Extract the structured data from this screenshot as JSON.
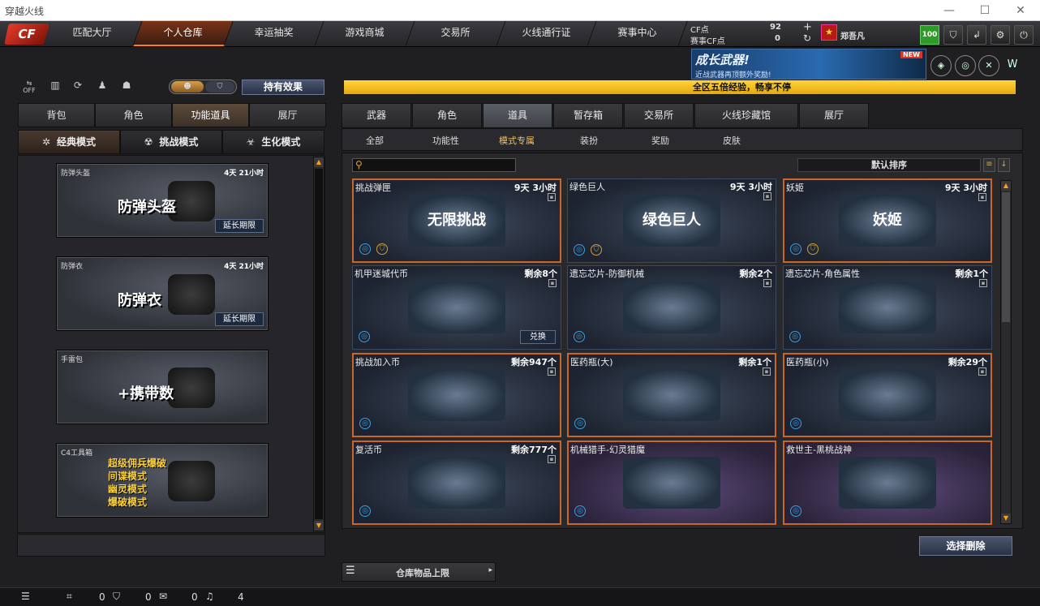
{
  "window": {
    "title": "穿越火线",
    "min": "—",
    "max": "☐",
    "close": "✕"
  },
  "nav": {
    "logo": "CF",
    "tabs": [
      "匹配大厅",
      "个人仓库",
      "幸运抽奖",
      "游戏商城",
      "交易所",
      "火线通行证",
      "赛事中心"
    ],
    "active": 1
  },
  "currency": {
    "cf_label": "CF点",
    "cf_value": "92",
    "event_label": "赛事CF点",
    "event_value": "0",
    "plus": "+",
    "refresh": "↻"
  },
  "user": {
    "name": "郑吾凡",
    "level": "100"
  },
  "banner": {
    "title": "成长武器!",
    "subtitle": "近战武器再顶额外奖励!",
    "badge": "NEW"
  },
  "ticker": {
    "text": "全区五倍经验，畅享不停"
  },
  "left": {
    "toggle": {
      "off": "OFF"
    },
    "effect_button": "持有效果",
    "tabs": [
      "背包",
      "角色",
      "功能道具",
      "展厅"
    ],
    "active_tab": 2,
    "modes": [
      "经典模式",
      "挑战模式",
      "生化模式"
    ],
    "active_mode": 0,
    "cards": [
      {
        "name": "防弹头盔",
        "time": "4天 21小时",
        "big": "防弹头盔",
        "extend": "延长期限"
      },
      {
        "name": "防弹衣",
        "time": "4天 21小时",
        "big": "防弹衣",
        "extend": "延长期限"
      },
      {
        "name": "手雷包",
        "time": "",
        "big": "+携带数",
        "extend": ""
      },
      {
        "name": "C4工具箱",
        "time": "",
        "lines": [
          "超级佣兵爆破",
          "间谍模式",
          "幽灵模式",
          "爆破模式"
        ],
        "extend": ""
      }
    ]
  },
  "right": {
    "tabs": [
      "武器",
      "角色",
      "道具",
      "暂存箱",
      "交易所",
      "火线珍藏馆",
      "展厅"
    ],
    "active_tab": 2,
    "subtabs": [
      "全部",
      "功能性",
      "模式专属",
      "装扮",
      "奖励",
      "皮肤"
    ],
    "active_sub": 2,
    "search_placeholder": "",
    "sort_label": "默认排序",
    "cards": [
      {
        "name": "挑战弹匣",
        "count": "9天 3小时",
        "art": "无限挑战",
        "sel": true
      },
      {
        "name": "绿色巨人",
        "count": "9天 3小时",
        "art": "绿色巨人",
        "sel": false
      },
      {
        "name": "妖姬",
        "count": "9天 3小时",
        "art": "妖姬",
        "sel": true
      },
      {
        "name": "机甲迷城代币",
        "count": "剩余8个",
        "art": "",
        "sel": false,
        "redeem": "兑换"
      },
      {
        "name": "遗忘芯片-防御机械",
        "count": "剩余2个",
        "art": "",
        "sel": false
      },
      {
        "name": "遗忘芯片-角色属性",
        "count": "剩余1个",
        "art": "",
        "sel": false
      },
      {
        "name": "挑战加入币",
        "count": "剩余947个",
        "art": "",
        "sel": true
      },
      {
        "name": "医药瓶(大)",
        "count": "剩余1个",
        "art": "",
        "sel": true
      },
      {
        "name": "医药瓶(小)",
        "count": "剩余29个",
        "art": "",
        "sel": true
      },
      {
        "name": "复活币",
        "count": "剩余777个",
        "art": "",
        "sel": true
      },
      {
        "name": "机械猎手-幻灵猎魔",
        "count": "",
        "art": "",
        "sel": true,
        "purple": true
      },
      {
        "name": "救世主-黑桃战神",
        "count": "",
        "art": "",
        "sel": true,
        "purple": true
      }
    ],
    "select_delete": "选择删除",
    "storage_limit": "仓库物品上限"
  },
  "status": {
    "v1": "0",
    "v2": "0",
    "v3": "0",
    "v4": "4"
  }
}
